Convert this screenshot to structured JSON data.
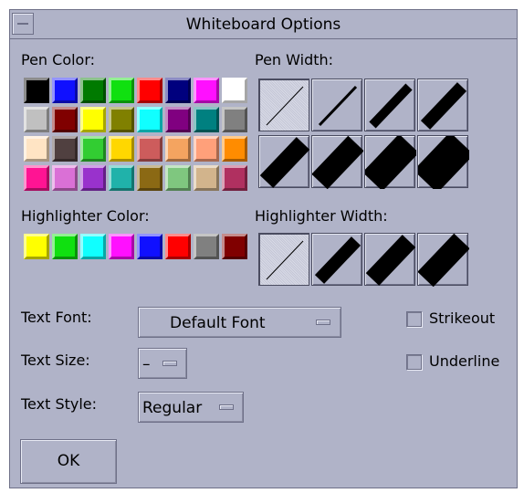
{
  "window": {
    "title": "Whiteboard Options"
  },
  "labels": {
    "pen_color": "Pen Color:",
    "pen_width": "Pen Width:",
    "highlighter_color": "Highlighter Color:",
    "highlighter_width": "Highlighter Width:",
    "text_font": "Text Font:",
    "text_size": "Text Size:",
    "text_style": "Text Style:"
  },
  "pen_colors": [
    [
      "#000000",
      "#1010ff",
      "#007a00",
      "#10e010",
      "#ff0000",
      "#00007e",
      "#ff10ff",
      "#ffffff"
    ],
    [
      "#c0c0c0",
      "#800000",
      "#ffff00",
      "#808000",
      "#10ffff",
      "#800080",
      "#008080",
      "#808080"
    ],
    [
      "#ffe4c4",
      "#504040",
      "#32cd32",
      "#ffd700",
      "#cd5c5c",
      "#f4a460",
      "#ffa07a",
      "#ff8c00"
    ],
    [
      "#ff1493",
      "#da70d6",
      "#9932cc",
      "#20b2aa",
      "#8b6914",
      "#7fc77f",
      "#d2b48c",
      "#b03060"
    ]
  ],
  "highlighter_colors": [
    "#ffff00",
    "#10e010",
    "#10ffff",
    "#ff10ff",
    "#1010ff",
    "#ff0000",
    "#808080",
    "#800000"
  ],
  "pen_width_count": 8,
  "pen_width_selected": 1,
  "highlighter_width_count": 4,
  "highlighter_width_selected": 1,
  "controls": {
    "font_value": "Default Font",
    "size_value": "–",
    "style_value": "Regular",
    "strikeout_label": "Strikeout",
    "underline_label": "Underline",
    "ok_label": "OK"
  }
}
